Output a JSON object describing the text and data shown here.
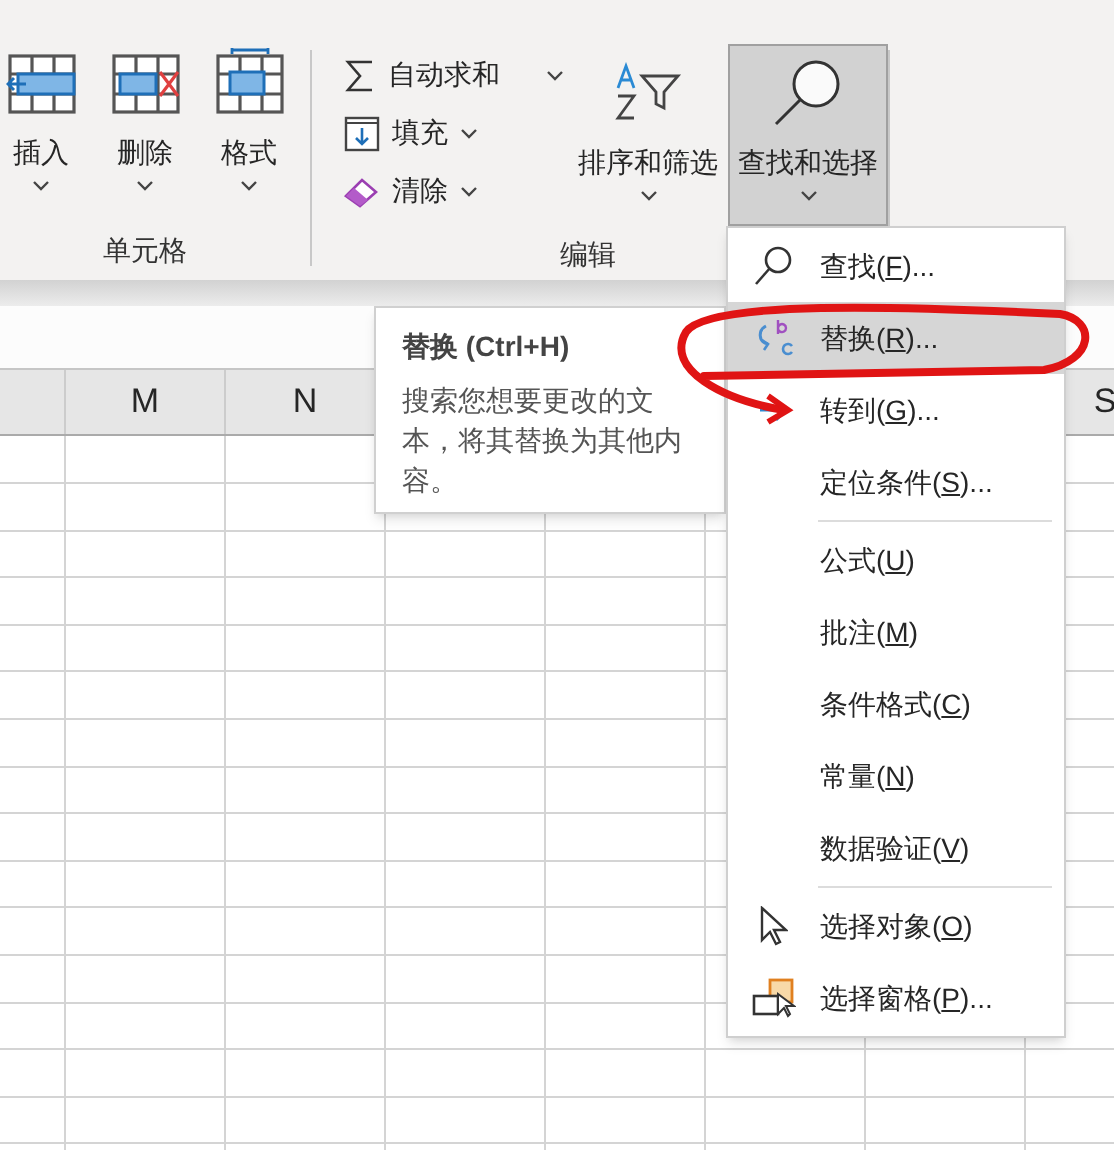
{
  "ribbon": {
    "cells_group": {
      "label": "单元格",
      "buttons": [
        {
          "label": "插入"
        },
        {
          "label": "删除"
        },
        {
          "label": "格式"
        }
      ]
    },
    "editing_group": {
      "label": "编辑",
      "small_buttons": [
        {
          "label": "自动求和"
        },
        {
          "label": "填充"
        },
        {
          "label": "清除"
        }
      ],
      "large_buttons": [
        {
          "label": "排序和筛选",
          "selected": false
        },
        {
          "label": "查找和选择",
          "selected": true
        }
      ]
    }
  },
  "column_headers": [
    "M",
    "N",
    "S"
  ],
  "tooltip": {
    "title": "替换 (Ctrl+H)",
    "description": "搜索您想要更改的文本，将其替换为其他内容。"
  },
  "menu": [
    {
      "kind": "item",
      "before": "查找(",
      "key": "F",
      "after": ")...",
      "selected": false
    },
    {
      "kind": "item",
      "before": "替换(",
      "key": "R",
      "after": ")...",
      "selected": true
    },
    {
      "kind": "item",
      "before": "转到(",
      "key": "G",
      "after": ")...",
      "selected": false
    },
    {
      "kind": "item",
      "before": "定位条件(",
      "key": "S",
      "after": ")...",
      "selected": false
    },
    {
      "kind": "separator"
    },
    {
      "kind": "item",
      "before": "公式(",
      "key": "U",
      "after": ")",
      "selected": false
    },
    {
      "kind": "item",
      "before": "批注(",
      "key": "M",
      "after": ")",
      "selected": false
    },
    {
      "kind": "item",
      "before": "条件格式(",
      "key": "C",
      "after": ")",
      "selected": false
    },
    {
      "kind": "item",
      "before": "常量(",
      "key": "N",
      "after": ")",
      "selected": false
    },
    {
      "kind": "item",
      "before": "数据验证(",
      "key": "V",
      "after": ")",
      "selected": false
    },
    {
      "kind": "separator"
    },
    {
      "kind": "item",
      "before": "选择对象(",
      "key": "O",
      "after": ")",
      "selected": false
    },
    {
      "kind": "item",
      "before": "选择窗格(",
      "key": "P",
      "after": ")...",
      "selected": false
    }
  ]
}
